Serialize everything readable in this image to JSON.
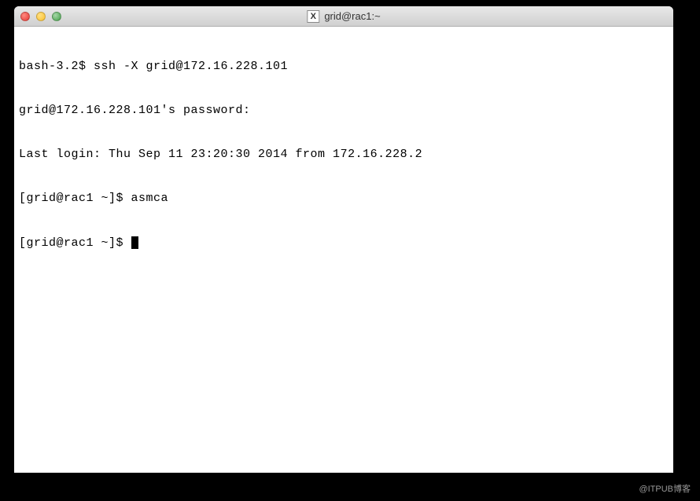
{
  "window": {
    "title": "grid@rac1:~",
    "icon_label": "X"
  },
  "terminal": {
    "lines": [
      "bash-3.2$ ssh -X grid@172.16.228.101",
      "grid@172.16.228.101's password:",
      "Last login: Thu Sep 11 23:20:30 2014 from 172.16.228.2",
      "[grid@rac1 ~]$ asmca",
      "[grid@rac1 ~]$ "
    ]
  },
  "watermark": "@ITPUB博客"
}
